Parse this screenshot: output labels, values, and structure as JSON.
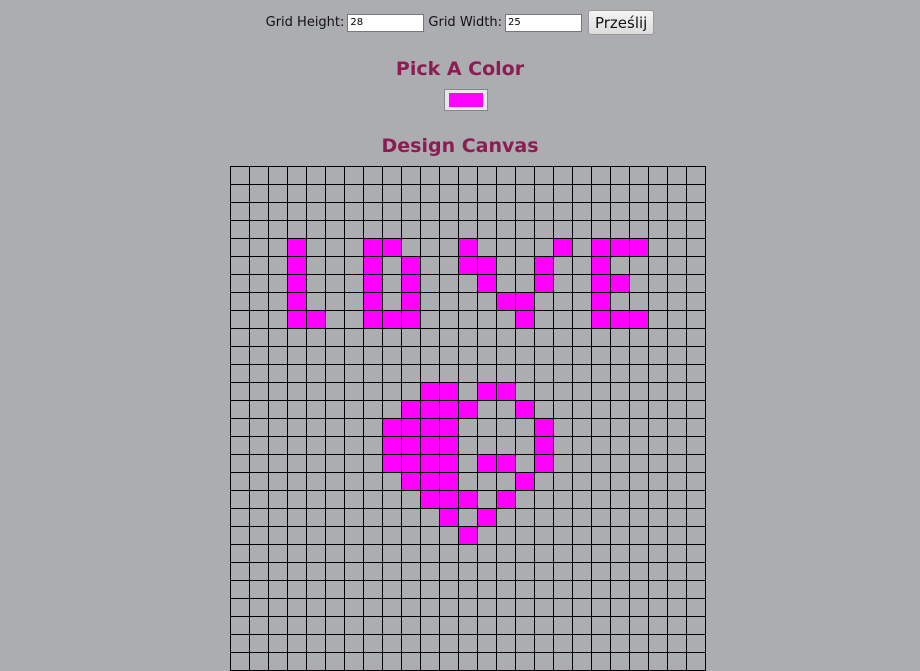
{
  "form": {
    "height_label": "Grid Height:",
    "height_value": "28",
    "width_label": "Grid Width:",
    "width_value": "25",
    "submit_label": "Prześlij"
  },
  "color_section": {
    "title": "Pick A Color",
    "selected_color": "#ff00ff"
  },
  "canvas_section": {
    "title": "Design Canvas",
    "rows": 28,
    "cols": 25,
    "filled_color": "#ff00ff",
    "filled_cells": [
      [
        4,
        3
      ],
      [
        4,
        7
      ],
      [
        4,
        8
      ],
      [
        4,
        12
      ],
      [
        4,
        17
      ],
      [
        4,
        19
      ],
      [
        4,
        20
      ],
      [
        4,
        21
      ],
      [
        5,
        3
      ],
      [
        5,
        7
      ],
      [
        5,
        9
      ],
      [
        5,
        12
      ],
      [
        5,
        13
      ],
      [
        5,
        16
      ],
      [
        5,
        19
      ],
      [
        6,
        3
      ],
      [
        6,
        7
      ],
      [
        6,
        9
      ],
      [
        6,
        13
      ],
      [
        6,
        16
      ],
      [
        6,
        19
      ],
      [
        6,
        20
      ],
      [
        7,
        3
      ],
      [
        7,
        7
      ],
      [
        7,
        9
      ],
      [
        7,
        14
      ],
      [
        7,
        15
      ],
      [
        7,
        19
      ],
      [
        8,
        3
      ],
      [
        8,
        4
      ],
      [
        8,
        7
      ],
      [
        8,
        8
      ],
      [
        8,
        9
      ],
      [
        8,
        15
      ],
      [
        8,
        19
      ],
      [
        8,
        20
      ],
      [
        8,
        21
      ],
      [
        12,
        10
      ],
      [
        12,
        11
      ],
      [
        12,
        13
      ],
      [
        12,
        14
      ],
      [
        13,
        9
      ],
      [
        13,
        10
      ],
      [
        13,
        11
      ],
      [
        13,
        12
      ],
      [
        13,
        15
      ],
      [
        14,
        8
      ],
      [
        14,
        9
      ],
      [
        14,
        10
      ],
      [
        14,
        11
      ],
      [
        14,
        16
      ],
      [
        15,
        8
      ],
      [
        15,
        9
      ],
      [
        15,
        10
      ],
      [
        15,
        11
      ],
      [
        15,
        16
      ],
      [
        16,
        8
      ],
      [
        16,
        9
      ],
      [
        16,
        10
      ],
      [
        16,
        11
      ],
      [
        16,
        13
      ],
      [
        16,
        14
      ],
      [
        16,
        16
      ],
      [
        17,
        9
      ],
      [
        17,
        10
      ],
      [
        17,
        11
      ],
      [
        17,
        15
      ],
      [
        18,
        10
      ],
      [
        18,
        11
      ],
      [
        18,
        12
      ],
      [
        18,
        14
      ],
      [
        19,
        11
      ],
      [
        19,
        13
      ],
      [
        20,
        12
      ]
    ]
  }
}
